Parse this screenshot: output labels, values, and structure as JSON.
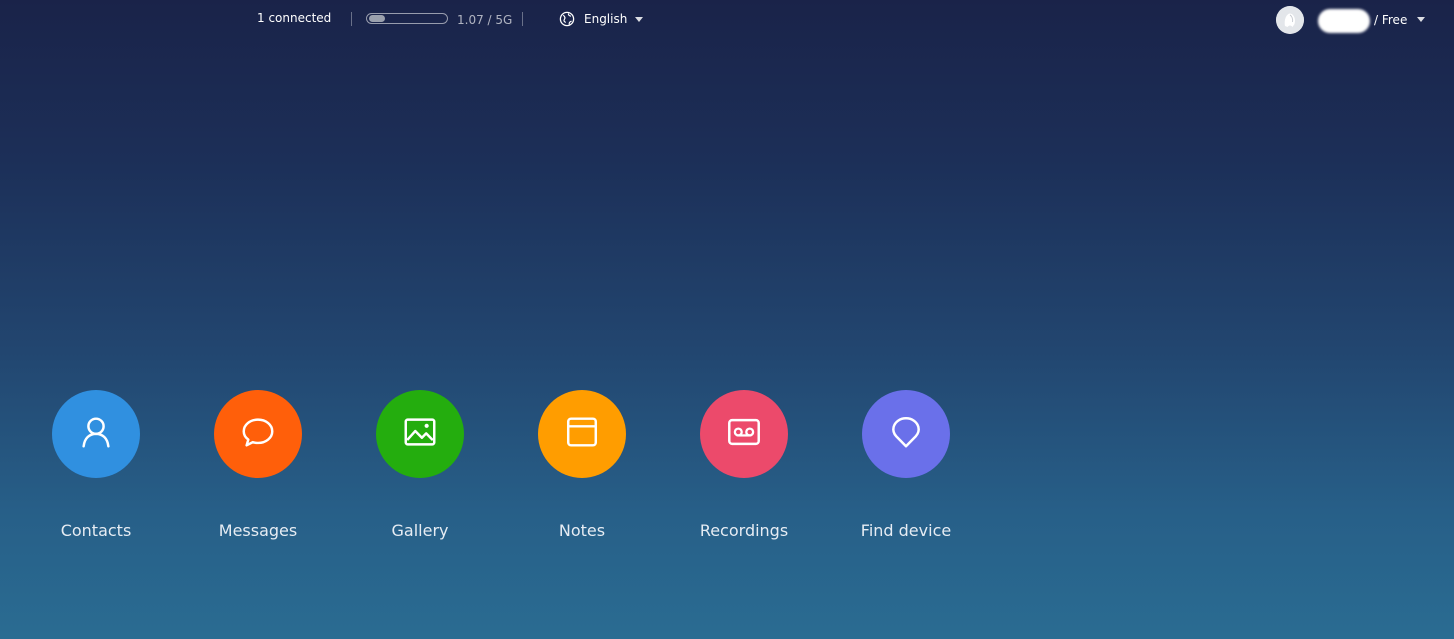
{
  "topbar": {
    "connected_label": "1 connected",
    "storage": {
      "used_fraction": 0.214,
      "text": "1.07 / 5G"
    },
    "language": {
      "label": "English",
      "icon": "globe-icon"
    },
    "account": {
      "plan_label": "/ Free"
    }
  },
  "apps": [
    {
      "label": "Contacts",
      "icon": "person-icon",
      "color": "#3090e0"
    },
    {
      "label": "Messages",
      "icon": "chat-bubble-icon",
      "color": "#ff5f0a"
    },
    {
      "label": "Gallery",
      "icon": "image-icon",
      "color": "#24ad0e"
    },
    {
      "label": "Notes",
      "icon": "note-window-icon",
      "color": "#ff9d00"
    },
    {
      "label": "Recordings",
      "icon": "cassette-icon",
      "color": "#ec4a6b"
    },
    {
      "label": "Find device",
      "icon": "location-pin-icon",
      "color": "#6a70ea"
    }
  ]
}
